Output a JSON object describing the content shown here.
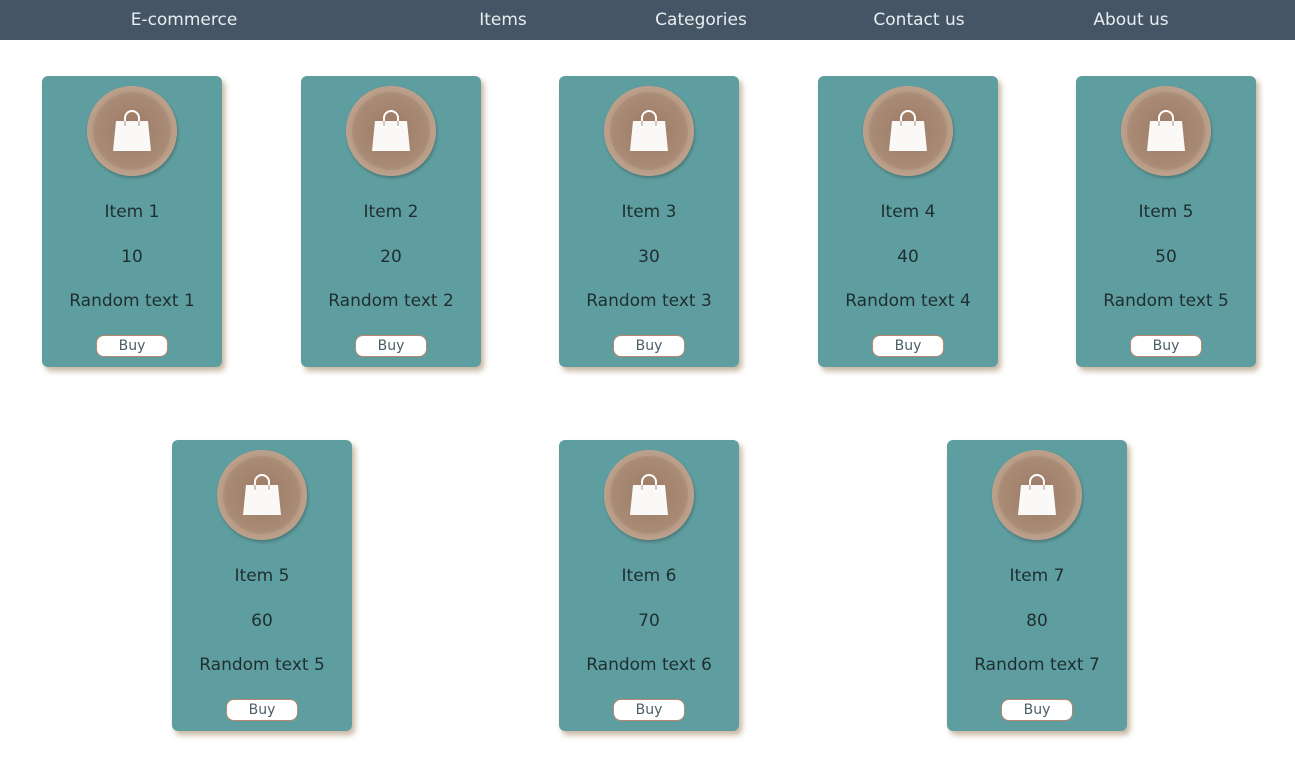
{
  "nav": {
    "brand": "E-commerce",
    "items": "Items",
    "categories": "Categories",
    "contact": "Contact us",
    "about": "About us"
  },
  "colors": {
    "navbar": "#455566",
    "card": "#5f9ea0",
    "avatar": "#a88a74",
    "button_border": "#b58a6c"
  },
  "icon": "shopping-bag-icon",
  "cards": [
    {
      "title": "Item 1",
      "price": "10",
      "desc": "Random text 1",
      "button": "Buy"
    },
    {
      "title": "Item 2",
      "price": "20",
      "desc": "Random text 2",
      "button": "Buy"
    },
    {
      "title": "Item 3",
      "price": "30",
      "desc": "Random text 3",
      "button": "Buy"
    },
    {
      "title": "Item 4",
      "price": "40",
      "desc": "Random text 4",
      "button": "Buy"
    },
    {
      "title": "Item 5",
      "price": "50",
      "desc": "Random text 5",
      "button": "Buy"
    },
    {
      "title": "Item 5",
      "price": "60",
      "desc": "Random text 5",
      "button": "Buy"
    },
    {
      "title": "Item 6",
      "price": "70",
      "desc": "Random text 6",
      "button": "Buy"
    },
    {
      "title": "Item 7",
      "price": "80",
      "desc": "Random text 7",
      "button": "Buy"
    }
  ]
}
